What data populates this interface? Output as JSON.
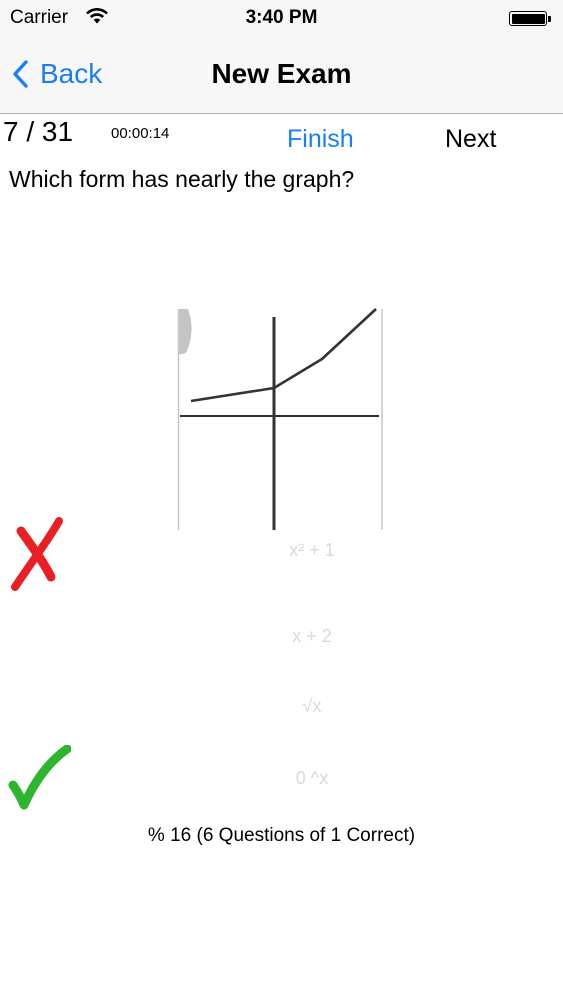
{
  "status_bar": {
    "carrier": "Carrier",
    "time": "3:40 PM",
    "wifi_icon": "wifi-icon",
    "battery_icon": "battery-icon"
  },
  "nav_bar": {
    "back_label": "Back",
    "title": "New Exam"
  },
  "exam": {
    "counter": "7 / 31",
    "timer": "00:00:14",
    "finish_label": "Finish",
    "next_label": "Next",
    "question": "Which form has nearly the graph?"
  },
  "answers": [
    {
      "label": "x² + 1",
      "mark": "wrong"
    },
    {
      "label": "x + 2",
      "mark": ""
    },
    {
      "label": "√x",
      "mark": ""
    },
    {
      "label": "0 ^x",
      "mark": "correct"
    }
  ],
  "marks": {
    "wrong_color": "#ea1f24",
    "correct_color": "#2db52d",
    "accent": "#1a7ff3"
  },
  "score": "% 16 (6 Questions of 1 Correct)"
}
